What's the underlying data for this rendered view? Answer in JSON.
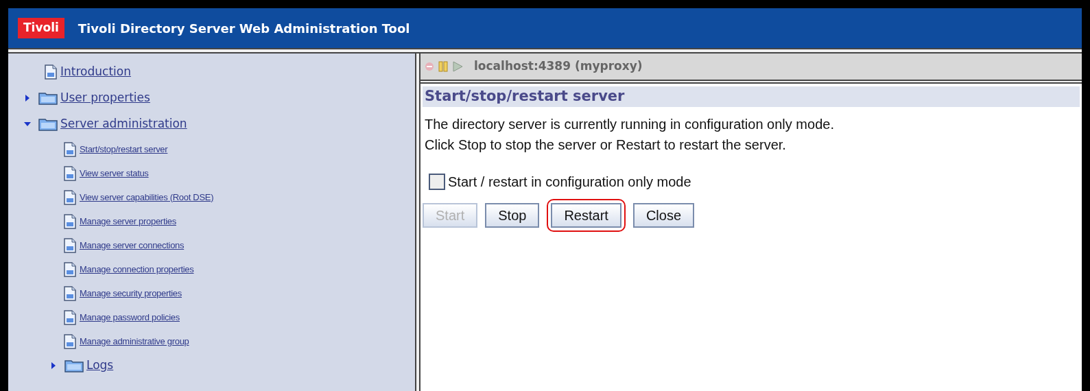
{
  "header": {
    "logo": "Tivoli",
    "title": "Tivoli Directory Server Web Administration Tool"
  },
  "tree": [
    {
      "kind": "page",
      "label": "Introduction"
    },
    {
      "kind": "folder",
      "label": "User properties",
      "expanded": false
    },
    {
      "kind": "folder",
      "label": "Server administration",
      "expanded": true,
      "children": [
        {
          "kind": "page",
          "label": "Start/stop/restart server"
        },
        {
          "kind": "page",
          "label": "View server status"
        },
        {
          "kind": "page",
          "label": "View server capabilities (Root DSE)"
        },
        {
          "kind": "page",
          "label": "Manage server properties"
        },
        {
          "kind": "page",
          "label": "Manage server connections"
        },
        {
          "kind": "page",
          "label": "Manage connection properties"
        },
        {
          "kind": "page",
          "label": "Manage security properties"
        },
        {
          "kind": "page",
          "label": "Manage password policies"
        },
        {
          "kind": "page",
          "label": "Manage administrative group"
        },
        {
          "kind": "folder",
          "label": "Logs",
          "expanded": false
        }
      ]
    }
  ],
  "toolbar": {
    "server": "localhost:4389 (myproxy)"
  },
  "panel": {
    "title": "Start/stop/restart server",
    "message": [
      "The directory server is currently running in configuration only mode.",
      "Click Stop to stop the server or Restart to restart the server."
    ],
    "option": {
      "label": "Start / restart in configuration only mode",
      "checked": false
    },
    "buttons": [
      {
        "label": "Start",
        "disabled": true,
        "highlighted": false
      },
      {
        "label": "Stop",
        "disabled": false,
        "highlighted": false
      },
      {
        "label": "Restart",
        "disabled": false,
        "highlighted": true
      },
      {
        "label": "Close",
        "disabled": false,
        "highlighted": false
      }
    ]
  }
}
